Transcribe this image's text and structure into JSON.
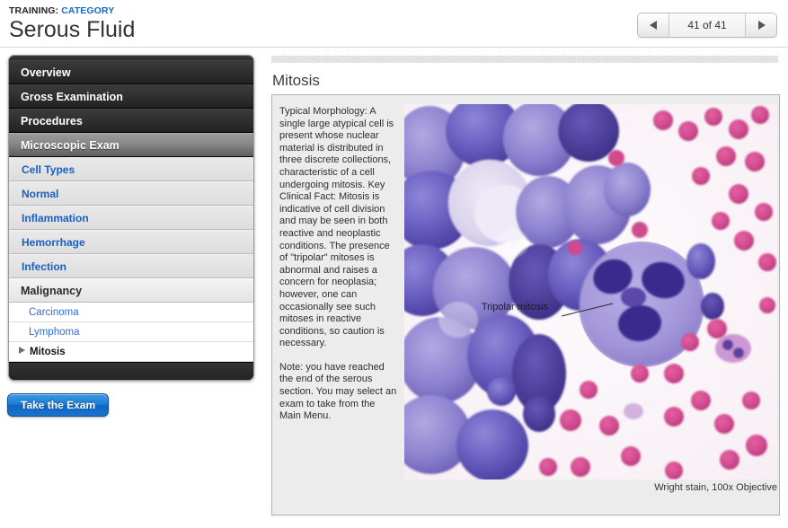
{
  "header": {
    "kicker_prefix": "TRAINING:",
    "kicker_category": "CATEGORY",
    "title": "Serous Fluid"
  },
  "pager": {
    "prev_icon": "triangle-left-icon",
    "next_icon": "triangle-right-icon",
    "label": "41 of 41"
  },
  "nav": {
    "main_items": [
      {
        "label": "Overview",
        "selected": false
      },
      {
        "label": "Gross Examination",
        "selected": false
      },
      {
        "label": "Procedures",
        "selected": false
      },
      {
        "label": "Microscopic Exam",
        "selected": true
      }
    ],
    "sub_items": [
      {
        "label": "Cell Types"
      },
      {
        "label": "Normal"
      },
      {
        "label": "Inflammation"
      },
      {
        "label": "Hemorrhage"
      },
      {
        "label": "Infection"
      }
    ],
    "group": {
      "label": "Malignancy"
    },
    "leaf_items": [
      {
        "label": "Carcinoma",
        "active": false
      },
      {
        "label": "Lymphoma",
        "active": false
      },
      {
        "label": "Mitosis",
        "active": true
      }
    ]
  },
  "exam_button": {
    "label": "Take the Exam"
  },
  "content": {
    "section_title": "Mitosis",
    "paragraph_1": "Typical Morphology: A single large atypical cell is present whose nuclear material is distributed in three discrete collections, characteristic of a cell undergoing mitosis. Key Clinical Fact: Mitosis is indicative of cell division and may be seen in both reactive and neoplastic conditions. The presence of \"tripolar\" mitoses is abnormal and raises a concern for neoplasia; however, one can occasionally see such mitoses in reactive conditions, so caution is necessary.",
    "paragraph_note": "Note: you have reached the end of the serous section. You may select an exam to take from the Main Menu.",
    "image_annotation": "Tripolar mitosis",
    "caption": "Wright stain, 100x Objective"
  },
  "colors": {
    "link_blue": "#1a5fc0",
    "category_blue": "#1569c7",
    "nav_dark": "#2b2b2b",
    "nav_selected": "#8a8a8a",
    "button_blue": "#1c7ad4",
    "panel_bg": "#ececec"
  }
}
